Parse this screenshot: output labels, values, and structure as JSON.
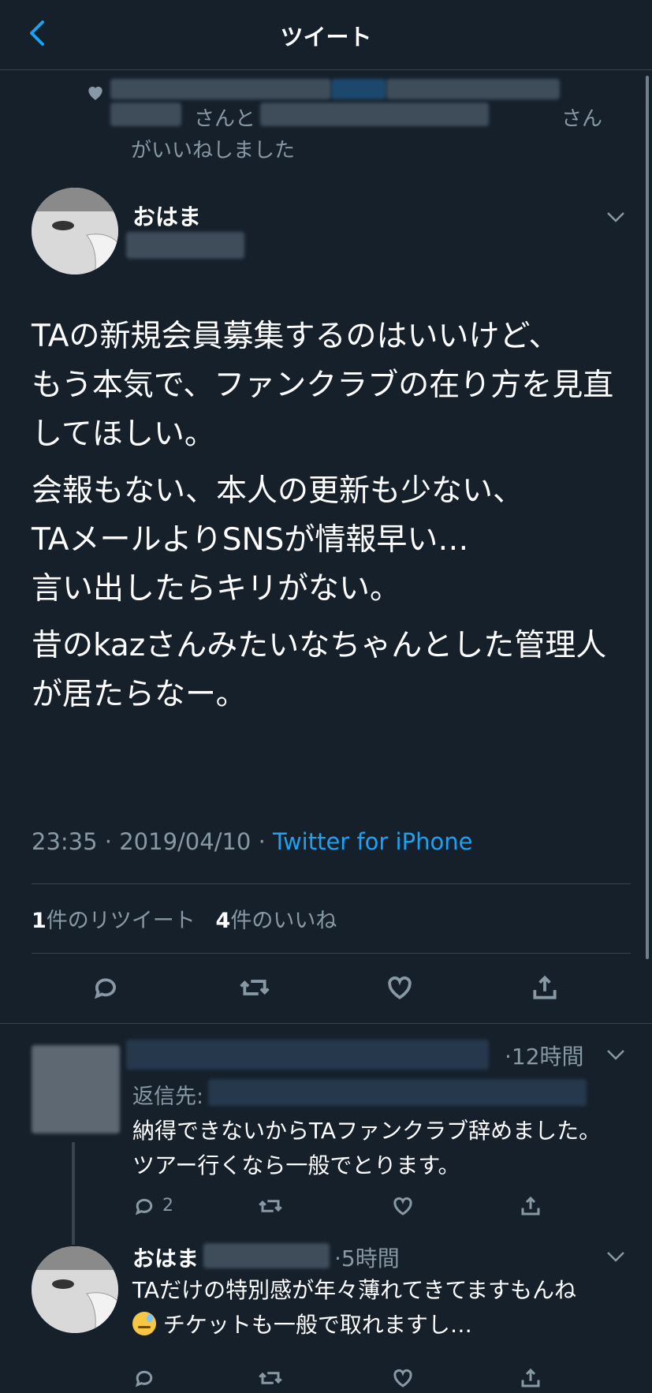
{
  "header": {
    "title": "ツイート"
  },
  "liked_by": {
    "text_a": "さんと",
    "text_b": "さん",
    "text_c": "がいいねしました"
  },
  "tweet": {
    "author": "おはま",
    "paragraphs": [
      "TAの新規会員募集するのはいいけど、\nもう本気で、ファンクラブの在り方を見直してほしい。",
      "会報もない、本人の更新も少ない、\nTAメールよりSNSが情報早い…\n言い出したらキリがない。",
      "昔のkazさんみたいなちゃんとした管理人が居たらなー。"
    ],
    "time": "23:35 · 2019/04/10 · ",
    "source": "Twitter for iPhone",
    "retweets_count": "1",
    "retweets_label": "件のリツイート",
    "likes_count": "4",
    "likes_label": "件のいいね"
  },
  "replies": [
    {
      "time": "·12時間",
      "reply_to_label": "返信先:",
      "text": "納得できないからTAファンクラブ辞めました。ツアー行くなら一般でとります。",
      "reply_count": "2"
    },
    {
      "author": "おはま",
      "time": "·5時間",
      "text_line1": "TAだけの特別感が年々薄れてきてますもんね",
      "text_line2": "チケットも一般で取れますし…",
      "emoji": "downcast-face-with-sweat"
    }
  ],
  "colors": {
    "background": "#15202b",
    "accent": "#1da1f2",
    "muted": "#8899a6",
    "divider": "#38444d"
  }
}
